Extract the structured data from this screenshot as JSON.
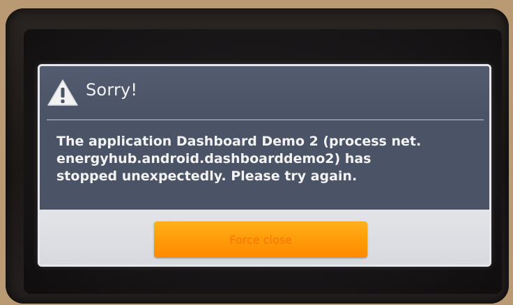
{
  "dialog": {
    "title": "Sorry!",
    "message_lines": [
      "The application Dashboard Demo 2 (process net.",
      "energyhub.android.dashboarddemo2) has",
      "stopped unexpectedly. Please try again."
    ],
    "button_label": "Force close",
    "icon": "warning-icon"
  },
  "colors": {
    "dialog_background": "#4b5466",
    "button_bar": "#dcdde2",
    "button_orange": "#ff9d0a"
  }
}
